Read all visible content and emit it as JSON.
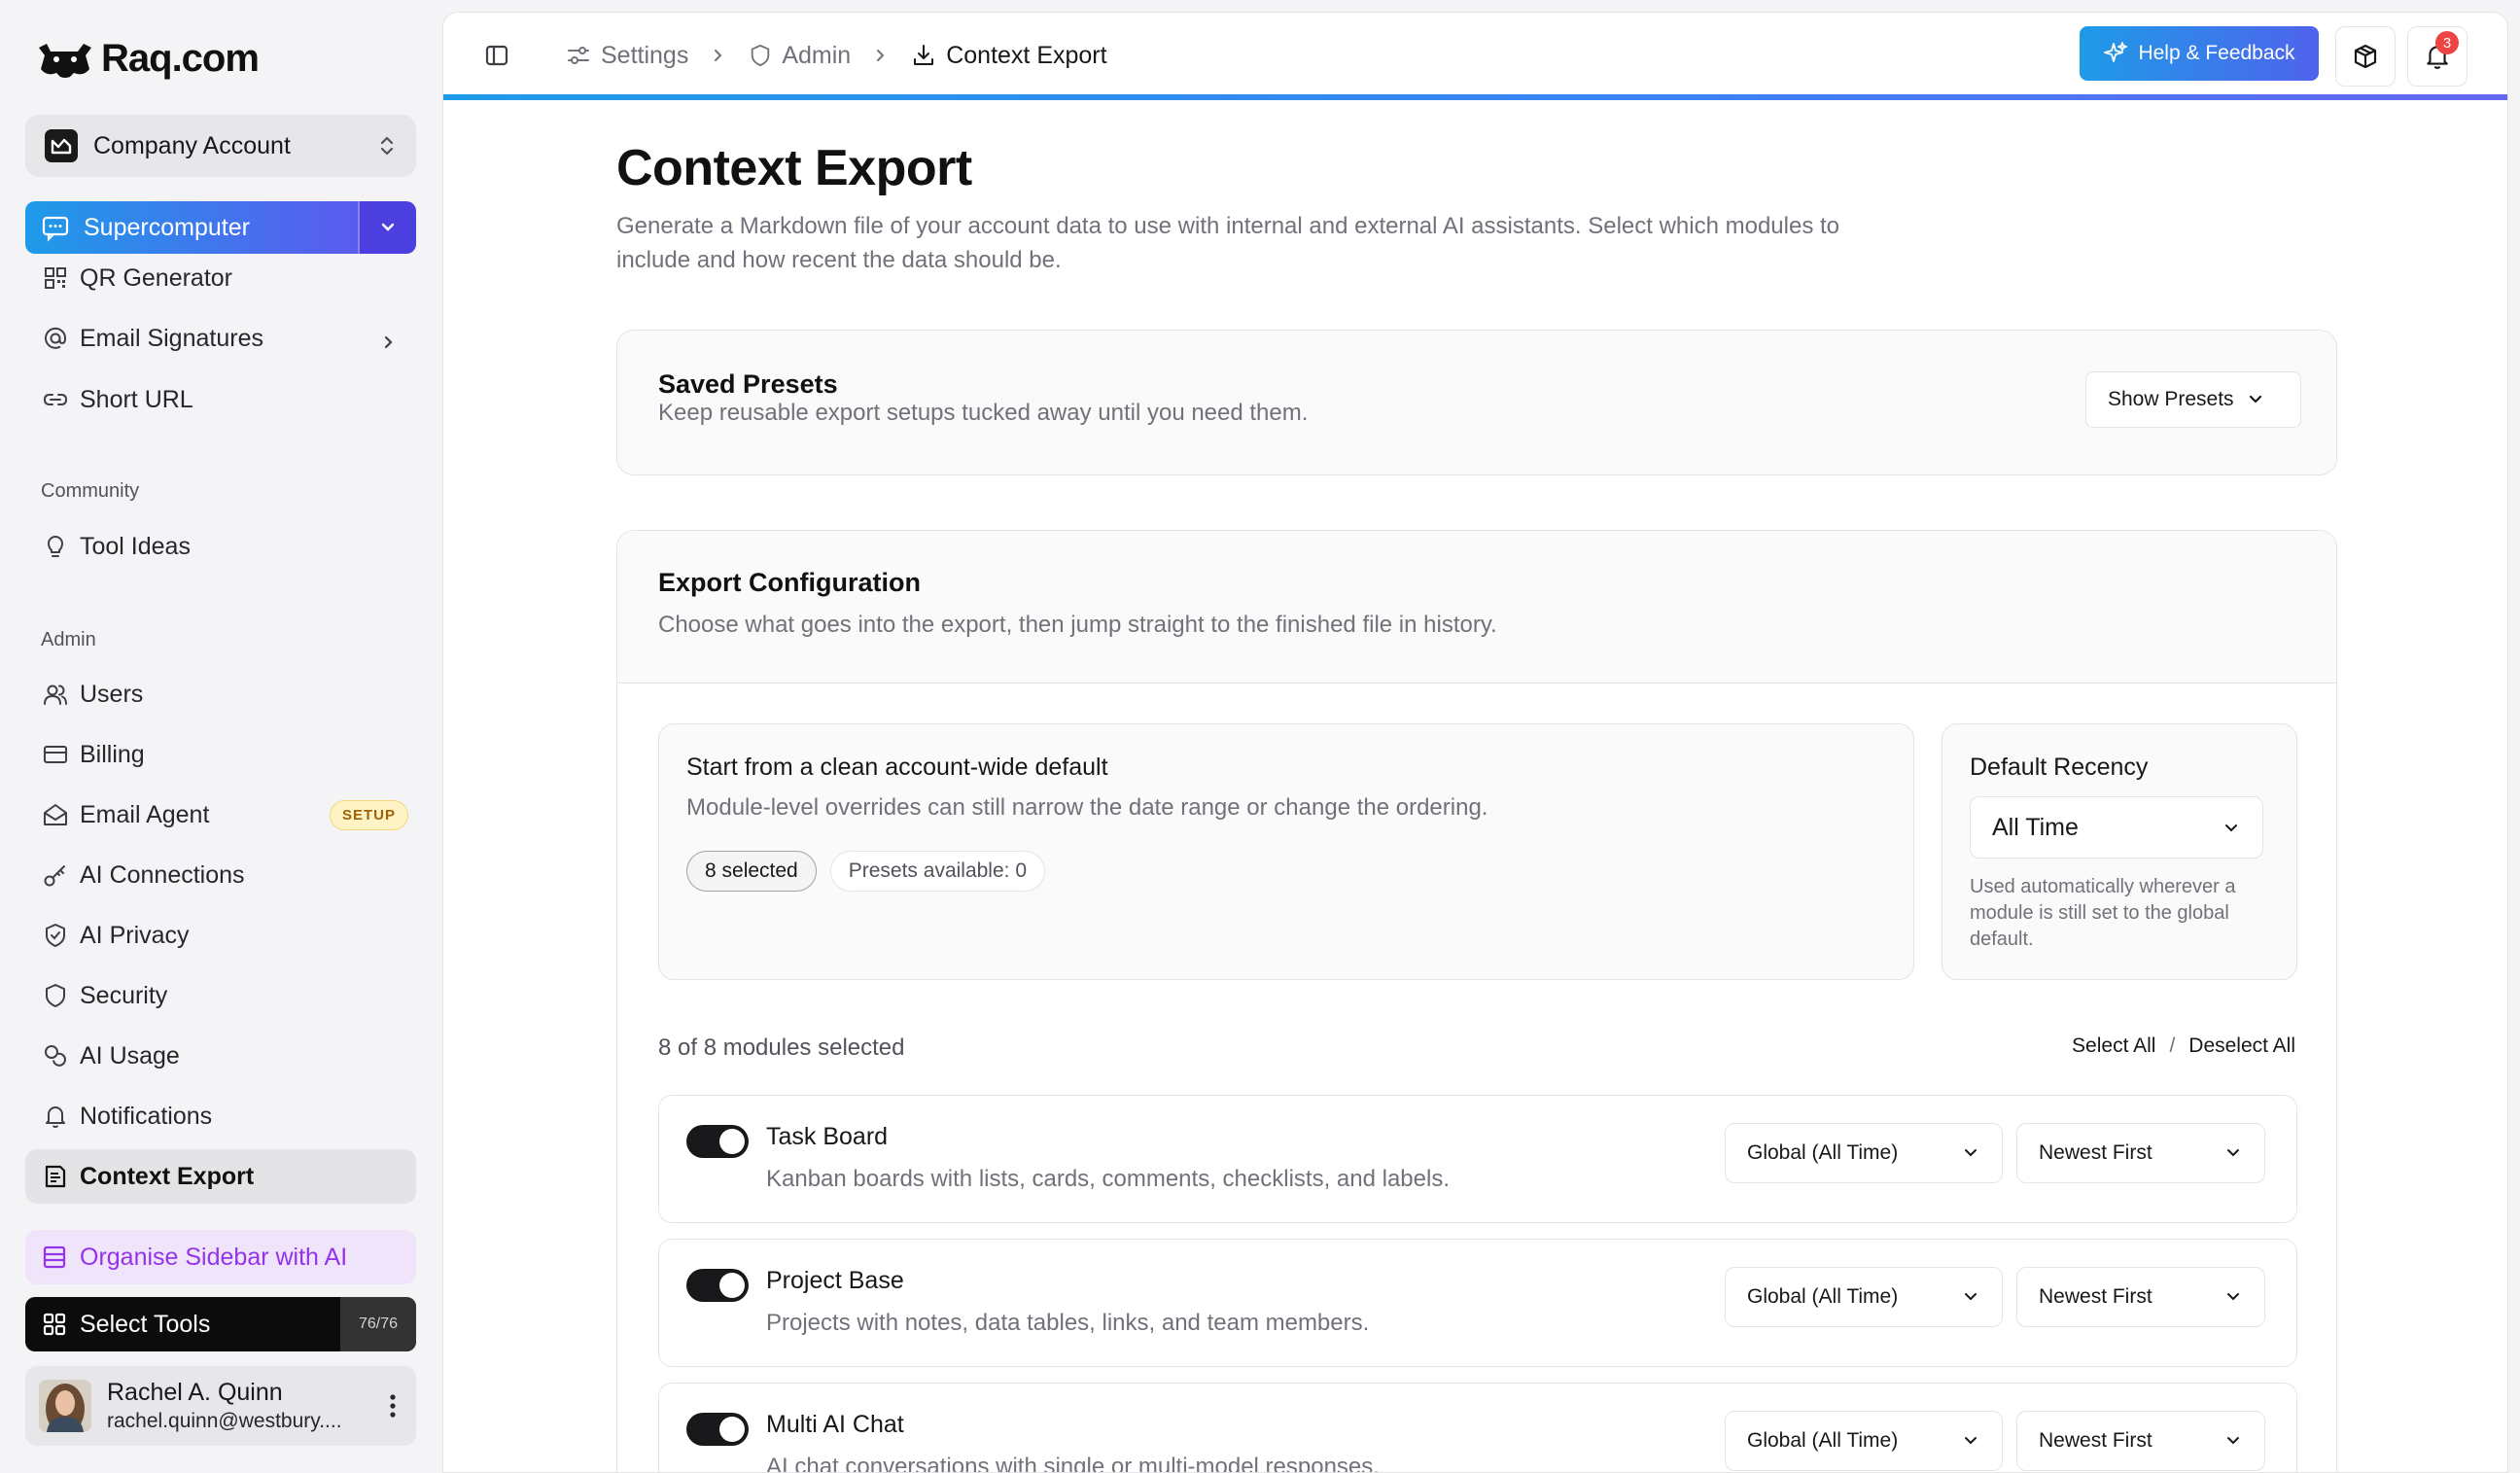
{
  "brand": {
    "name": "Raq.com"
  },
  "account": {
    "name": "Company Account"
  },
  "sidebar": {
    "supercomputer": "Supercomputer",
    "tools": [
      {
        "label": "QR Generator"
      },
      {
        "label": "Email Signatures"
      },
      {
        "label": "Short URL"
      }
    ],
    "community_label": "Community",
    "community": [
      {
        "label": "Tool Ideas"
      }
    ],
    "admin_label": "Admin",
    "admin": [
      {
        "label": "Users"
      },
      {
        "label": "Billing"
      },
      {
        "label": "Email Agent",
        "badge": "SETUP"
      },
      {
        "label": "AI Connections"
      },
      {
        "label": "AI Privacy"
      },
      {
        "label": "Security"
      },
      {
        "label": "AI Usage"
      },
      {
        "label": "Notifications"
      },
      {
        "label": "Context Export"
      }
    ],
    "organise": "Organise Sidebar with AI",
    "select_tools": "Select Tools",
    "tools_count": "76/76"
  },
  "user": {
    "name": "Rachel A. Quinn",
    "email": "rachel.quinn@westbury...."
  },
  "breadcrumb": [
    "Settings",
    "Admin",
    "Context Export"
  ],
  "topbar": {
    "help": "Help & Feedback",
    "notification_count": "3"
  },
  "page": {
    "title": "Context Export",
    "description": "Generate a Markdown file of your account data to use with internal and external AI assistants. Select which modules to include and how recent the data should be."
  },
  "presets": {
    "title": "Saved Presets",
    "subtitle": "Keep reusable export setups tucked away until you need them.",
    "button": "Show Presets"
  },
  "config": {
    "title": "Export Configuration",
    "subtitle": "Choose what goes into the export, then jump straight to the finished file in history.",
    "default_title": "Start from a clean account-wide default",
    "default_sub": "Module-level overrides can still narrow the date range or change the ordering.",
    "selected_pill": "8 selected",
    "presets_pill": "Presets available: 0",
    "recency_title": "Default Recency",
    "recency_value": "All Time",
    "recency_help": "Used automatically wherever a module is still set to the global default.",
    "modules_count": "8 of 8 modules selected",
    "select_all": "Select All",
    "slash": "/",
    "deselect_all": "Deselect All"
  },
  "modules": [
    {
      "title": "Task Board",
      "desc": "Kanban boards with lists, cards, comments, checklists, and labels.",
      "range": "Global (All Time)",
      "order": "Newest First"
    },
    {
      "title": "Project Base",
      "desc": "Projects with notes, data tables, links, and team members.",
      "range": "Global (All Time)",
      "order": "Newest First"
    },
    {
      "title": "Multi AI Chat",
      "desc": "AI chat conversations with single or multi-model responses.",
      "range": "Global (All Time)",
      "order": "Newest First"
    }
  ],
  "colors": {
    "accent_start": "#1e9be8",
    "accent_end": "#5b5bf0",
    "organise_text": "#9333ea",
    "setup_badge": "#fdf3c4"
  }
}
